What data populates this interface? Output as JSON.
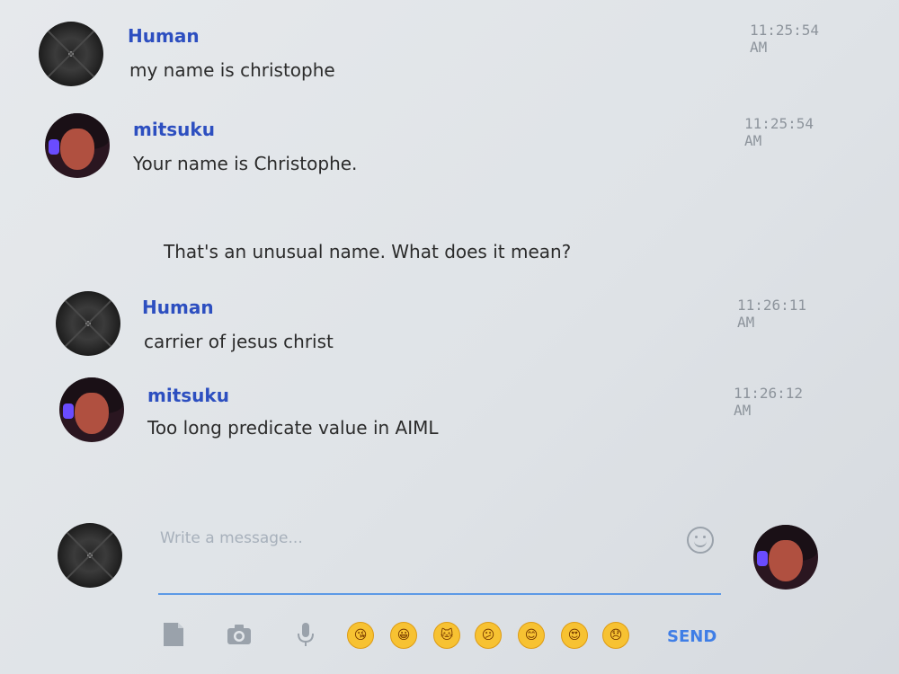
{
  "messages": [
    {
      "sender": "Human",
      "time": "11:25:54 AM",
      "text": "my name is christophe"
    },
    {
      "sender": "mitsuku",
      "time": "11:25:54 AM",
      "text": "Your name is Christophe.",
      "text2": "That's an unusual name. What does it mean?"
    },
    {
      "sender": "Human",
      "time": "11:26:11 AM",
      "text": "carrier of jesus christ"
    },
    {
      "sender": "mitsuku",
      "time": "11:26:12 AM",
      "text": "Too long predicate value in AIML"
    }
  ],
  "composer": {
    "placeholder": "Write a message...",
    "send_label": "SEND"
  },
  "icons": {
    "smile": "smile-icon",
    "file": "file-icon",
    "camera": "camera-icon",
    "mic": "microphone-icon",
    "emojis": [
      "kiss-emoji",
      "grin-emoji",
      "cat-emoji",
      "confused-emoji",
      "blush-emoji",
      "heart-eyes-emoji",
      "sad-emoji"
    ]
  },
  "colors": {
    "name": "#2d4fc0",
    "accent": "#3f7ee6",
    "underline": "#5c99e6"
  }
}
